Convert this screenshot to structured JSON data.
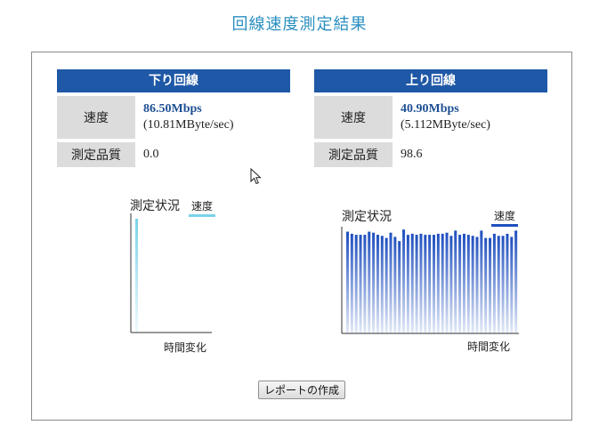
{
  "page": {
    "title": "回線速度測定結果"
  },
  "download": {
    "header": "下り回線",
    "speed_label": "速度",
    "speed_value": "86.50Mbps",
    "speed_bytes": "(10.81MByte/sec)",
    "quality_label": "測定品質",
    "quality_value": "0.0"
  },
  "upload": {
    "header": "上り回線",
    "speed_label": "速度",
    "speed_value": "40.90Mbps",
    "speed_bytes": "(5.112MByte/sec)",
    "quality_label": "測定品質",
    "quality_value": "98.6"
  },
  "colors": {
    "header_bg": "#1e58a6",
    "title": "#2a8fc0",
    "download_series": "#7ad3ea",
    "upload_series": "#1e4fbf"
  },
  "chart_data": [
    {
      "type": "bar",
      "title": "測定状況",
      "xlabel": "時間変化",
      "ylabel": "",
      "series": [
        {
          "name": "速度",
          "values": [
            1.0
          ]
        }
      ],
      "ylim": [
        0,
        1
      ],
      "grid": false,
      "legend_position": "top-right"
    },
    {
      "type": "bar",
      "title": "測定状況",
      "xlabel": "時間変化",
      "ylabel": "",
      "series": [
        {
          "name": "速度",
          "values": [
            0.97,
            0.95,
            0.94,
            0.94,
            0.94,
            0.97,
            0.96,
            0.94,
            0.93,
            0.91,
            0.96,
            0.92,
            0.88,
            0.99,
            0.94,
            0.95,
            0.94,
            0.95,
            0.94,
            0.94,
            0.94,
            0.95,
            0.95,
            0.96,
            0.93,
            0.98,
            0.94,
            0.95,
            0.94,
            0.93,
            0.92,
            0.98,
            0.91,
            0.91,
            0.95,
            0.93,
            0.93,
            0.95,
            0.92,
            0.98
          ]
        }
      ],
      "ylim": [
        0,
        1
      ],
      "grid": false,
      "legend_position": "top-right"
    }
  ]
}
